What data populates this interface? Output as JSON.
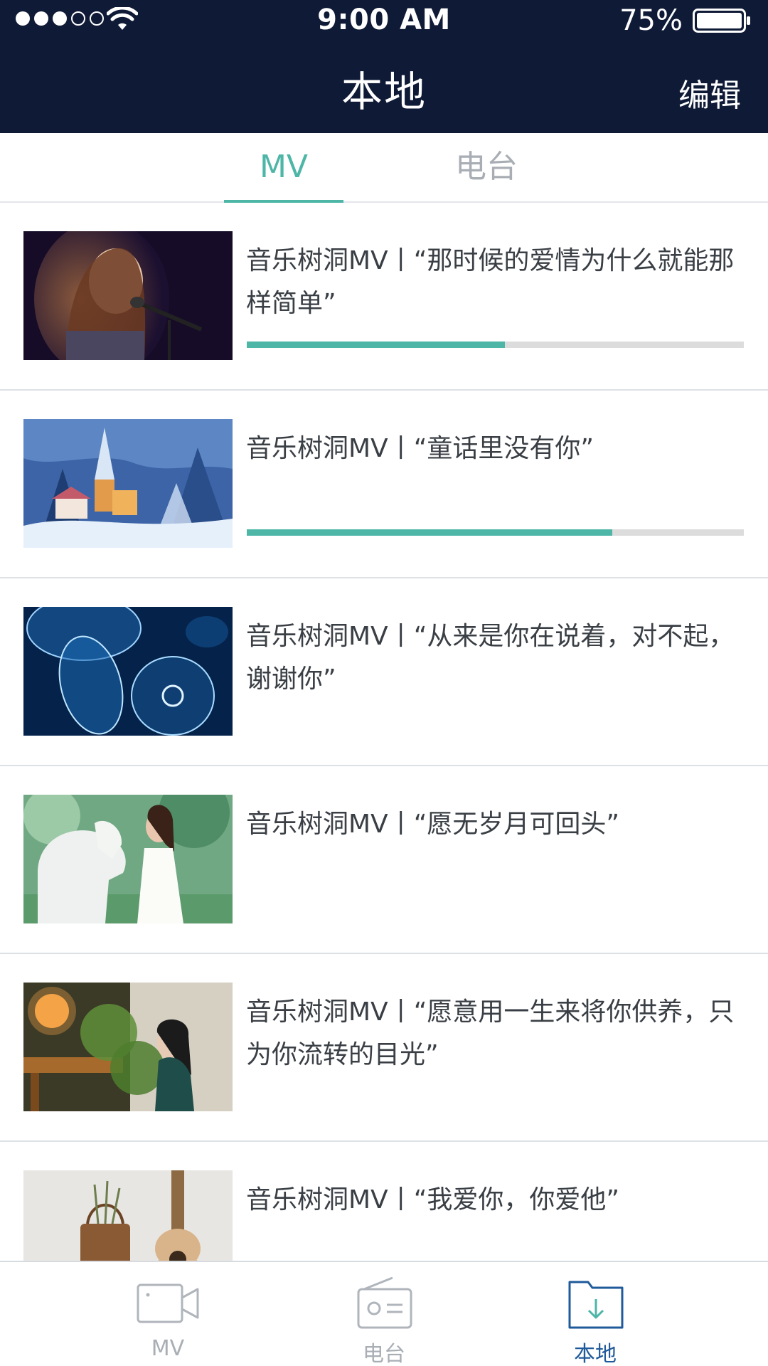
{
  "status_bar": {
    "time": "9:00 AM",
    "battery": "75%",
    "signal_icon": "signal-dots-icon",
    "wifi_icon": "wifi-icon",
    "battery_icon": "battery-icon"
  },
  "header": {
    "title": "本地",
    "edit_label": "编辑",
    "background": "#0f1a36"
  },
  "tabs": [
    {
      "label": "MV",
      "active": true
    },
    {
      "label": "电台",
      "active": false
    }
  ],
  "accent_color": "#4db6a7",
  "list": [
    {
      "title": "音乐树洞MV丨“那时候的爱情为什么就能那样简单”",
      "progress": 0.52,
      "thumb": "woman-singing-microphone"
    },
    {
      "title": "音乐树洞MV丨“童话里没有你”",
      "progress": 0.735,
      "thumb": "snowy-church-village"
    },
    {
      "title": "音乐树洞MV丨“从来是你在说着，对不起，谢谢你”",
      "progress": null,
      "thumb": "blue-jellyfish"
    },
    {
      "title": "音乐树洞MV丨“愿无岁月可回头”",
      "progress": null,
      "thumb": "girl-with-white-horse"
    },
    {
      "title": "音乐树洞MV丨“愿意用一生来将你供养，只为你流转的目光”",
      "progress": null,
      "thumb": "girl-sitting-with-lamp"
    },
    {
      "title": "音乐树洞MV丨“我爱你，你爱他”",
      "progress": null,
      "thumb": "ukulele-and-basket"
    }
  ],
  "bottom_nav": [
    {
      "label": "MV",
      "icon": "video-camera-icon",
      "active": false
    },
    {
      "label": "电台",
      "icon": "radio-icon",
      "active": false
    },
    {
      "label": "本地",
      "icon": "download-folder-icon",
      "active": true
    }
  ]
}
